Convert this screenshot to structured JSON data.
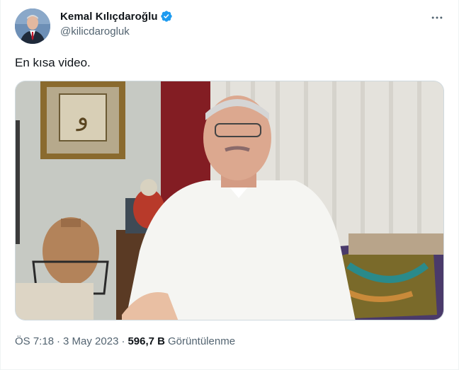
{
  "author": {
    "display_name": "Kemal Kılıçdaroğlu",
    "handle": "@kilicdarogluk",
    "verified": true
  },
  "tweet": {
    "text": "En kısa video.",
    "media_type": "video"
  },
  "meta": {
    "time": "ÖS 7:18",
    "separator": "·",
    "date": "3 May 2023",
    "views_count": "596,7 B",
    "views_label": "Görüntülenme"
  },
  "icons": {
    "more": "more-horizontal-icon",
    "verified": "verified-badge-icon"
  },
  "colors": {
    "accent": "#1d9bf0",
    "secondary_text": "#536471",
    "primary_text": "#0f1419",
    "border": "#cfd9de"
  }
}
